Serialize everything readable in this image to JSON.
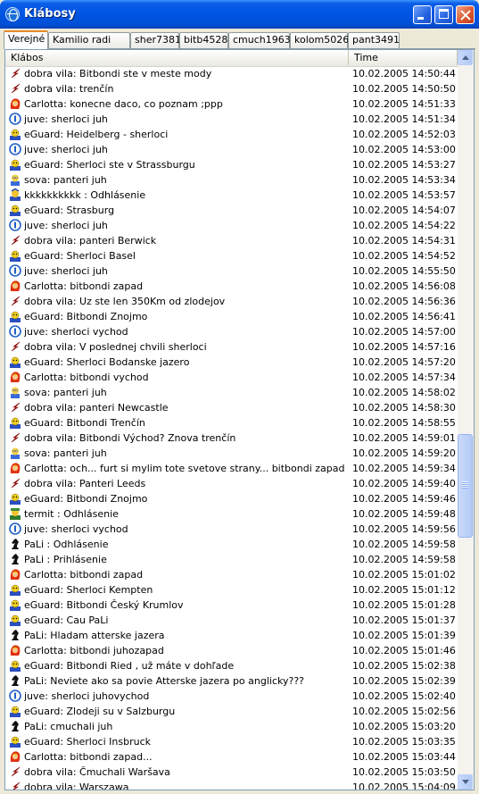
{
  "window": {
    "title": "Klábosy"
  },
  "tabs": [
    {
      "label": "Verejné",
      "active": true
    },
    {
      "label": "Kamilio radi",
      "active": false
    },
    {
      "label": "sher7381",
      "active": false
    },
    {
      "label": "bitb4528",
      "active": false
    },
    {
      "label": "cmuch1963",
      "active": false
    },
    {
      "label": "kolom5026",
      "active": false
    },
    {
      "label": "pant3491",
      "active": false
    }
  ],
  "table": {
    "columns": [
      "Klábos",
      "Time"
    ],
    "rows": [
      {
        "icon": "red-arrow-icon",
        "text": "dobra vila: Bitbondi ste v meste mody",
        "time": "10.02.2005 14:50:44"
      },
      {
        "icon": "red-arrow-icon",
        "text": "dobra vila: trenčín",
        "time": "10.02.2005 14:50:50"
      },
      {
        "icon": "carlotta-avatar-icon",
        "text": "Carlotta: konecne daco, co poznam ;ppp",
        "time": "10.02.2005 14:51:33"
      },
      {
        "icon": "blue-circle-icon",
        "text": "juve: sherloci juh",
        "time": "10.02.2005 14:51:34"
      },
      {
        "icon": "eguard-avatar-icon",
        "text": "eGuard: Heidelberg - sherloci",
        "time": "10.02.2005 14:52:03"
      },
      {
        "icon": "blue-circle-icon",
        "text": "juve: sherloci juh",
        "time": "10.02.2005 14:53:00"
      },
      {
        "icon": "eguard-avatar-icon",
        "text": "eGuard: Sherloci ste v Strassburgu",
        "time": "10.02.2005 14:53:27"
      },
      {
        "icon": "sova-avatar-icon",
        "text": "sova: panteri juh",
        "time": "10.02.2005 14:53:34"
      },
      {
        "icon": "kkkk-avatar-icon",
        "text": "kkkkkkkkkk : Odhlásenie",
        "time": "10.02.2005 14:53:57"
      },
      {
        "icon": "eguard-avatar-icon",
        "text": "eGuard: Strasburg",
        "time": "10.02.2005 14:54:07"
      },
      {
        "icon": "blue-circle-icon",
        "text": "juve: sherloci juh",
        "time": "10.02.2005 14:54:22"
      },
      {
        "icon": "red-arrow-icon",
        "text": "dobra vila: panteri Berwick",
        "time": "10.02.2005 14:54:31"
      },
      {
        "icon": "eguard-avatar-icon",
        "text": "eGuard: Sherloci Basel",
        "time": "10.02.2005 14:54:52"
      },
      {
        "icon": "blue-circle-icon",
        "text": "juve: sherloci juh",
        "time": "10.02.2005 14:55:50"
      },
      {
        "icon": "carlotta-avatar-icon",
        "text": "Carlotta: bitbondi zapad",
        "time": "10.02.2005 14:56:08"
      },
      {
        "icon": "red-arrow-icon",
        "text": "dobra vila: Uz ste len 350Km od zlodejov",
        "time": "10.02.2005 14:56:36"
      },
      {
        "icon": "eguard-avatar-icon",
        "text": "eGuard: Bitbondi Znojmo",
        "time": "10.02.2005 14:56:41"
      },
      {
        "icon": "blue-circle-icon",
        "text": "juve: sherloci vychod",
        "time": "10.02.2005 14:57:00"
      },
      {
        "icon": "red-arrow-icon",
        "text": "dobra vila: V poslednej chvili sherloci",
        "time": "10.02.2005 14:57:16"
      },
      {
        "icon": "eguard-avatar-icon",
        "text": "eGuard: Sherloci Bodanske jazero",
        "time": "10.02.2005 14:57:20"
      },
      {
        "icon": "carlotta-avatar-icon",
        "text": "Carlotta: bitbondi vychod",
        "time": "10.02.2005 14:57:34"
      },
      {
        "icon": "sova-avatar-icon",
        "text": "sova: panteri juh",
        "time": "10.02.2005 14:58:02"
      },
      {
        "icon": "red-arrow-icon",
        "text": "dobra vila: panteri Newcastle",
        "time": "10.02.2005 14:58:30"
      },
      {
        "icon": "eguard-avatar-icon",
        "text": "eGuard: Bitbondi Trenčín",
        "time": "10.02.2005 14:58:55"
      },
      {
        "icon": "red-arrow-icon",
        "text": "dobra vila: Bitbondi Východ? Znova trenčín",
        "time": "10.02.2005 14:59:01"
      },
      {
        "icon": "sova-avatar-icon",
        "text": "sova: panteri juh",
        "time": "10.02.2005 14:59:20"
      },
      {
        "icon": "carlotta-avatar-icon",
        "text": "Carlotta: och... furt si mylim tote svetove strany... bitbondi zapad ;p",
        "time": "10.02.2005 14:59:34"
      },
      {
        "icon": "red-arrow-icon",
        "text": "dobra vila: Panteri Leeds",
        "time": "10.02.2005 14:59:40"
      },
      {
        "icon": "eguard-avatar-icon",
        "text": "eGuard: Bitbondi Znojmo",
        "time": "10.02.2005 14:59:46"
      },
      {
        "icon": "termit-avatar-icon",
        "text": "termit : Odhlásenie",
        "time": "10.02.2005 14:59:48"
      },
      {
        "icon": "blue-circle-icon",
        "text": "juve: sherloci vychod",
        "time": "10.02.2005 14:59:56"
      },
      {
        "icon": "chess-knight-icon",
        "text": "PaLi : Odhlásenie",
        "time": "10.02.2005 14:59:58"
      },
      {
        "icon": "chess-knight-icon",
        "text": "PaLi : Prihlásenie",
        "time": "10.02.2005 14:59:58"
      },
      {
        "icon": "carlotta-avatar-icon",
        "text": "Carlotta: bitbondi zapad",
        "time": "10.02.2005 15:01:02"
      },
      {
        "icon": "eguard-avatar-icon",
        "text": "eGuard: Sherloci Kempten",
        "time": "10.02.2005 15:01:12"
      },
      {
        "icon": "eguard-avatar-icon",
        "text": "eGuard: Bitbondi Český Krumlov",
        "time": "10.02.2005 15:01:28"
      },
      {
        "icon": "eguard-avatar-icon",
        "text": "eGuard: Cau PaLi",
        "time": "10.02.2005 15:01:37"
      },
      {
        "icon": "chess-knight-icon",
        "text": "PaLi: Hladam atterske jazera",
        "time": "10.02.2005 15:01:39"
      },
      {
        "icon": "carlotta-avatar-icon",
        "text": "Carlotta: bitbondi juhozapad",
        "time": "10.02.2005 15:01:46"
      },
      {
        "icon": "eguard-avatar-icon",
        "text": "eGuard: Bitbondi Ried , už máte v dohľade",
        "time": "10.02.2005 15:02:38"
      },
      {
        "icon": "chess-knight-icon",
        "text": "PaLi: Neviete ako sa povie Atterske jazera po anglicky???",
        "time": "10.02.2005 15:02:39"
      },
      {
        "icon": "blue-circle-icon",
        "text": "juve: sherloci juhovychod",
        "time": "10.02.2005 15:02:40"
      },
      {
        "icon": "eguard-avatar-icon",
        "text": "eGuard: Zlodeji su v Salzburgu",
        "time": "10.02.2005 15:02:56"
      },
      {
        "icon": "chess-knight-icon",
        "text": "PaLi: cmuchali juh",
        "time": "10.02.2005 15:03:20"
      },
      {
        "icon": "eguard-avatar-icon",
        "text": "eGuard: Sherloci Insbruck",
        "time": "10.02.2005 15:03:35"
      },
      {
        "icon": "carlotta-avatar-icon",
        "text": "Carlotta: bitbondi zapad...",
        "time": "10.02.2005 15:03:44"
      },
      {
        "icon": "red-arrow-icon",
        "text": "dobra vila: Čmuchali Waršava",
        "time": "10.02.2005 15:03:50"
      },
      {
        "icon": "red-arrow-icon",
        "text": "dobra vila: Warszawa",
        "time": "10.02.2005 15:04:09"
      }
    ]
  }
}
